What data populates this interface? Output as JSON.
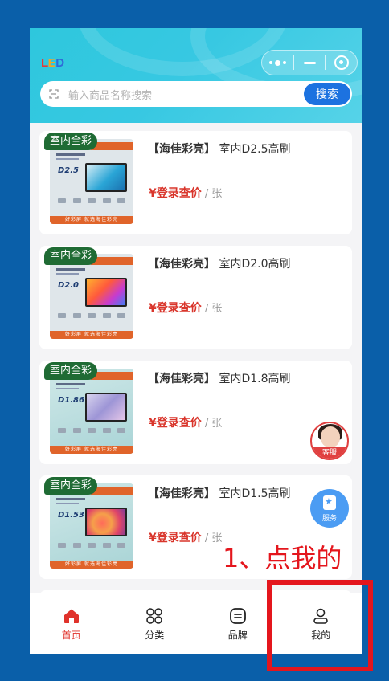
{
  "header": {
    "logo_text": {
      "l": "L",
      "e": "E",
      "d": "D"
    },
    "search": {
      "placeholder": "输入商品名称搜索",
      "button_label": "搜索"
    },
    "colors": {
      "gradient_start": "#2ec7dd",
      "search_button": "#1c72e0"
    }
  },
  "products": [
    {
      "badge": "室内全彩",
      "brand": "【海佳彩亮】",
      "name": "室内D2.5高刷",
      "price": "¥登录查价",
      "unit": " / 张",
      "model": "D2.5"
    },
    {
      "badge": "室内全彩",
      "brand": "【海佳彩亮】",
      "name": "室内D2.0高刷",
      "price": "¥登录查价",
      "unit": " / 张",
      "model": "D2.0"
    },
    {
      "badge": "室内全彩",
      "brand": "【海佳彩亮】",
      "name": "室内D1.8高刷",
      "price": "¥登录查价",
      "unit": " / 张",
      "model": "D1.86"
    },
    {
      "badge": "室内全彩",
      "brand": "【海佳彩亮】",
      "name": "室内D1.5高刷",
      "price": "¥登录查价",
      "unit": " / 张",
      "model": "D1.53"
    }
  ],
  "thumb_footer": "好彩屏 就选海佳彩亮",
  "floating": {
    "customer_service_label": "客服",
    "service_label": "服务"
  },
  "tabbar": [
    {
      "label": "首页",
      "icon": "home-icon",
      "active": true
    },
    {
      "label": "分类",
      "icon": "category-icon",
      "active": false
    },
    {
      "label": "品牌",
      "icon": "brand-icon",
      "active": false
    },
    {
      "label": "我的",
      "icon": "profile-icon",
      "active": false
    }
  ],
  "annotation": {
    "text": "1、点我的",
    "color": "#e4161d"
  },
  "colors": {
    "price": "#d9352b",
    "badge": "#1f6b34",
    "active_tab": "#e0322b"
  }
}
